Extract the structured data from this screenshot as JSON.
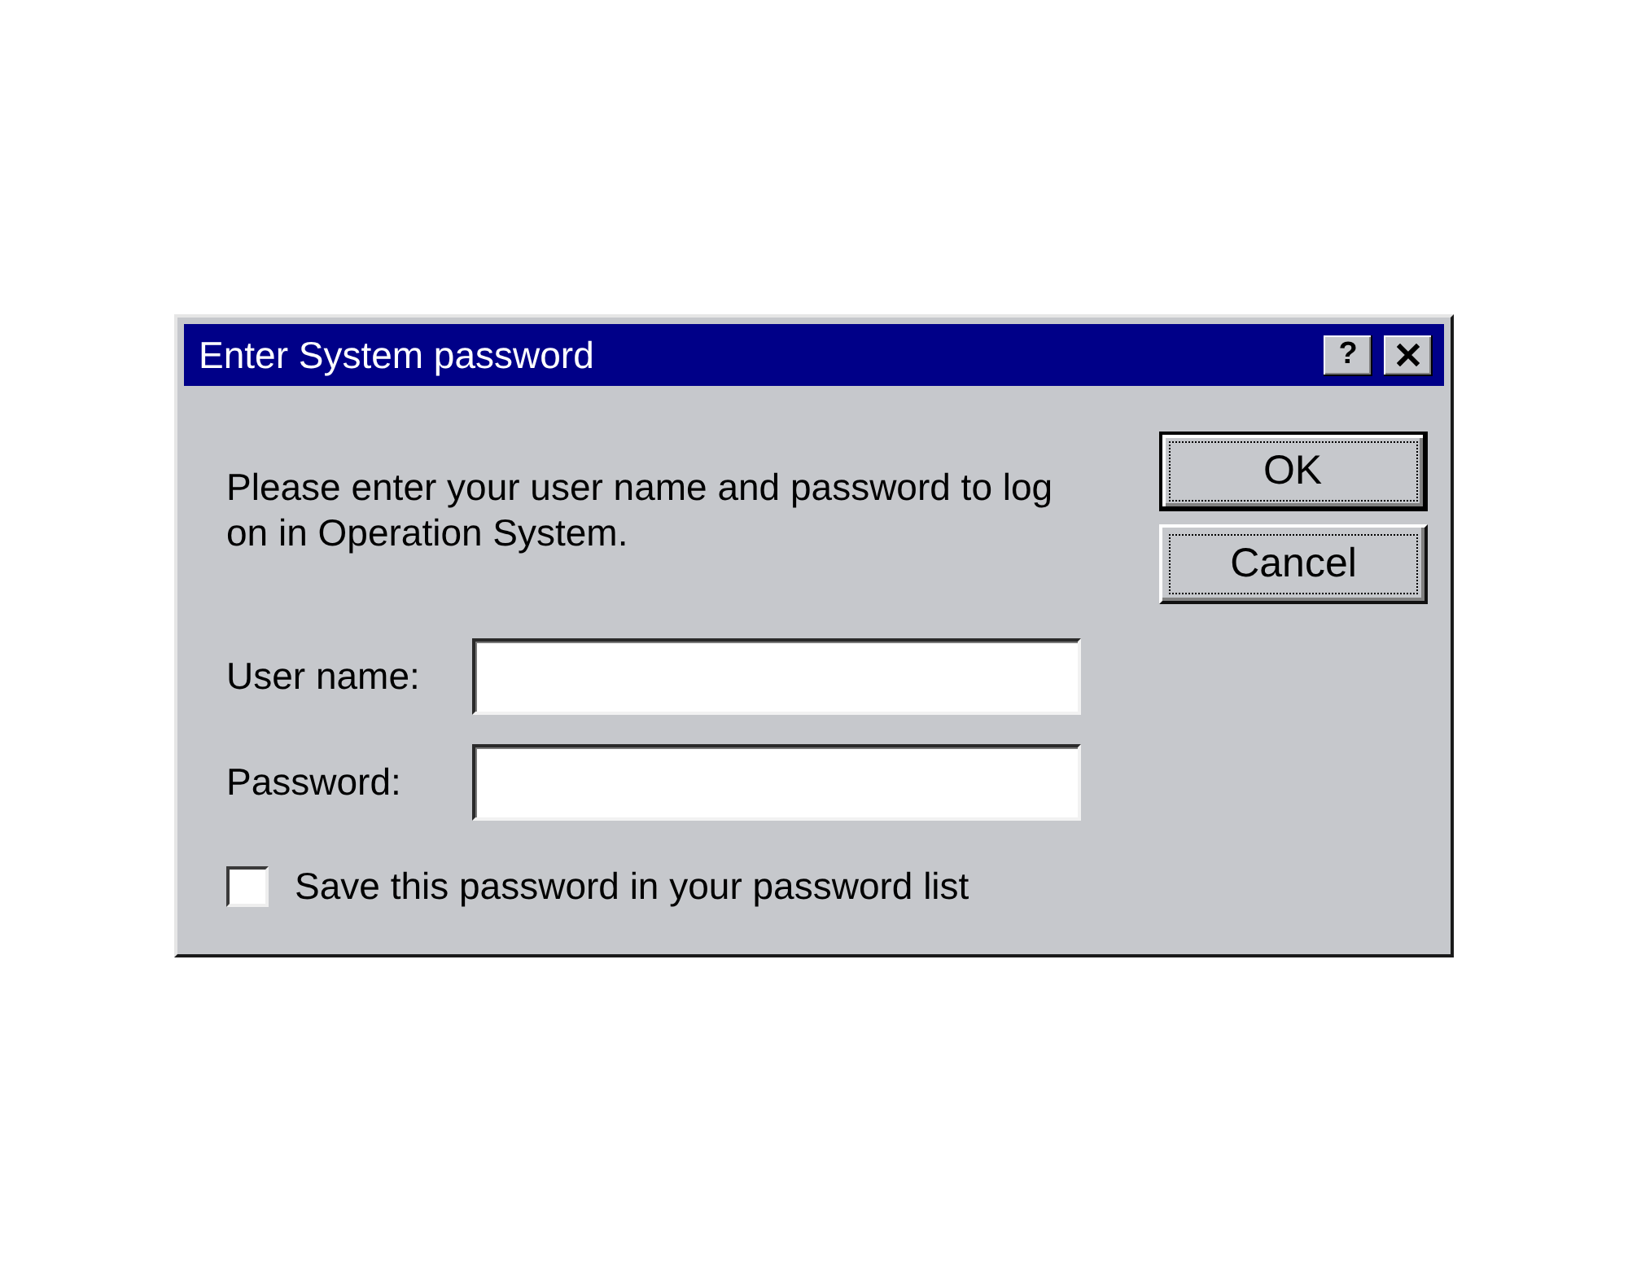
{
  "window": {
    "title": "Enter System password",
    "help_button": "?"
  },
  "message": "Please enter your user name and password to log on in Operation System.",
  "fields": [
    {
      "label": "User name:"
    },
    {
      "label": "Password:"
    }
  ],
  "checkbox": {
    "label": "Save this password in your password list",
    "checked": false
  },
  "buttons": [
    {
      "label": "OK",
      "default": true
    },
    {
      "label": "Cancel",
      "default": false
    }
  ]
}
